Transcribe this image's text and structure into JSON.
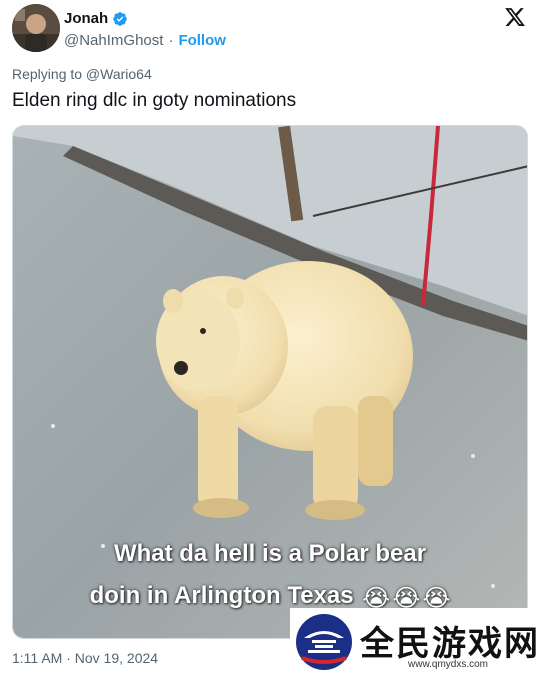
{
  "author": {
    "name": "Jonah",
    "handle": "@NahImGhost",
    "separator": "·",
    "follow_label": "Follow",
    "verified": true,
    "verified_color": "#1d9bf0"
  },
  "reply": {
    "replying_to": "Replying to @Wario64"
  },
  "tweet": {
    "text": "Elden ring dlc in goty nominations",
    "timestamp": "1:11 AM · Nov 19, 2024"
  },
  "media": {
    "caption_line1": "What da hell is a Polar bear",
    "caption_line2": "doin in Arlington Texas",
    "caption_emoji": [
      "😭",
      "😭",
      "😭"
    ]
  },
  "watermark": {
    "title": "全民游戏网",
    "url": "www.qmydxs.com"
  },
  "icons": {
    "platform": "x-logo-icon",
    "verified": "verified-badge-icon"
  },
  "colors": {
    "accent": "#1d9bf0",
    "text": "#0f1419",
    "muted": "#536471"
  }
}
